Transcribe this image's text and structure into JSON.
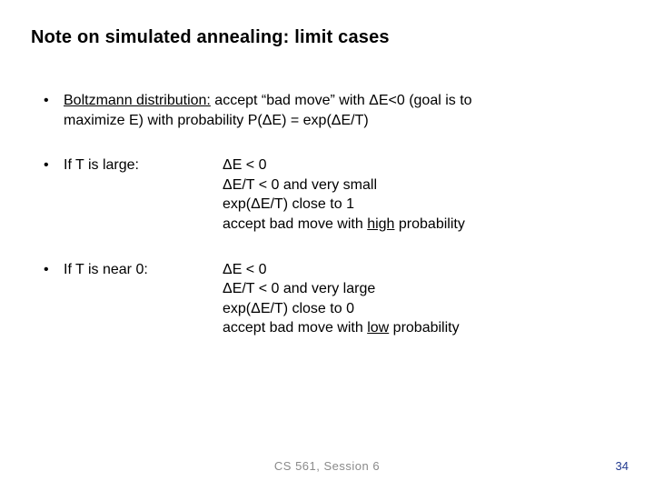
{
  "title": "Note on simulated annealing: limit cases",
  "bullets": {
    "boltzmann": {
      "term": "Boltzmann distribution:",
      "rest1": " accept “bad move” with ΔE<0 (goal is to",
      "rest2": "maximize E) with probability P(ΔE) = exp(ΔE/T)"
    },
    "large": {
      "label": "If T is large:",
      "l1": "ΔE < 0",
      "l2": "ΔE/T < 0 and very small",
      "l3": "exp(ΔE/T) close to 1",
      "l4a": "accept bad move with ",
      "l4word": "high",
      "l4b": " probability"
    },
    "near0": {
      "label": "If T is near 0:",
      "l1": "ΔE < 0",
      "l2": "ΔE/T < 0 and very large",
      "l3": "exp(ΔE/T) close to 0",
      "l4a": "accept bad move with ",
      "l4word": "low",
      "l4b": " probability"
    }
  },
  "footer": "CS 561,  Session 6",
  "page_number": "34"
}
